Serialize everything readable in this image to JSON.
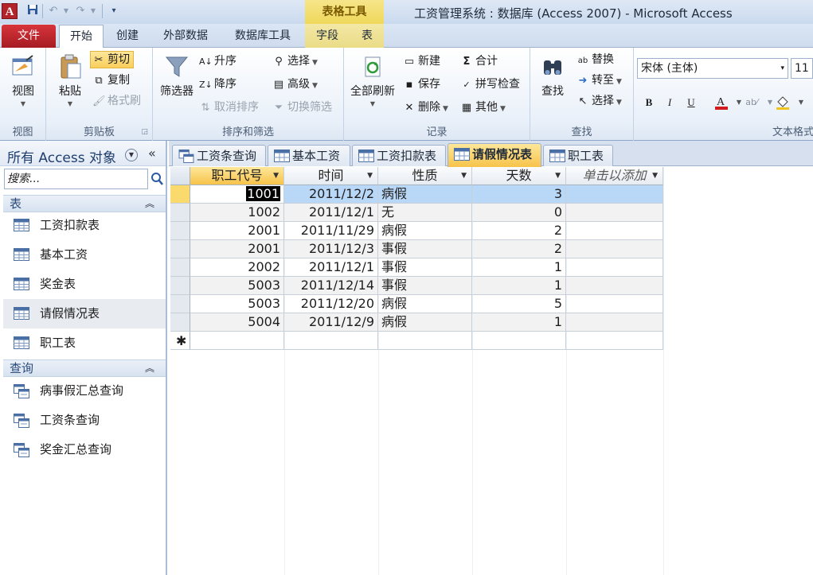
{
  "window": {
    "title": "工资管理系统 : 数据库 (Access 2007)  -  Microsoft Access",
    "context_tab_title": "表格工具",
    "app_icon_letter": "A"
  },
  "ribbon_tabs": [
    "文件",
    "开始",
    "创建",
    "外部数据",
    "数据库工具",
    "字段",
    "表"
  ],
  "ribbon": {
    "view": {
      "label": "视图",
      "group": "视图"
    },
    "clipboard": {
      "paste": "粘贴",
      "cut": "剪切",
      "copy": "复制",
      "format_painter": "格式刷",
      "group": "剪贴板"
    },
    "sort_filter": {
      "filter": "筛选器",
      "ascending": "升序",
      "descending": "降序",
      "clear_sort": "取消排序",
      "selection": "选择",
      "advanced": "高级",
      "toggle_filter": "切换筛选",
      "group": "排序和筛选"
    },
    "records": {
      "refresh_all": "全部刷新",
      "new": "新建",
      "save": "保存",
      "delete": "删除",
      "totals": "合计",
      "spelling": "拼写检查",
      "more": "其他",
      "group": "记录"
    },
    "find": {
      "find": "查找",
      "replace": "替换",
      "goto": "转至",
      "select": "选择",
      "group": "查找"
    },
    "text_format": {
      "font": "宋体 (主体)",
      "size": "11",
      "bold": "B",
      "italic": "I",
      "underline": "U",
      "group": "文本格式"
    }
  },
  "nav_pane": {
    "title": "所有 Access 对象",
    "search_placeholder": "搜索...",
    "sections": [
      {
        "label": "表",
        "items": [
          "工资扣款表",
          "基本工资",
          "奖金表",
          "请假情况表",
          "职工表"
        ]
      },
      {
        "label": "查询",
        "items": [
          "病事假汇总查询",
          "工资条查询",
          "奖金汇总查询"
        ]
      }
    ],
    "selected_item": "请假情况表"
  },
  "doc_tabs": [
    "工资条查询",
    "基本工资",
    "工资扣款表",
    "请假情况表",
    "职工表"
  ],
  "active_doc_tab": "请假情况表",
  "datasheet": {
    "columns": [
      "职工代号",
      "时间",
      "性质",
      "天数",
      "单击以添加"
    ],
    "rows": [
      [
        "1001",
        "2011/12/2",
        "病假",
        "3"
      ],
      [
        "1002",
        "2011/12/1",
        "无",
        "0"
      ],
      [
        "2001",
        "2011/11/29",
        "病假",
        "2"
      ],
      [
        "2001",
        "2011/12/3",
        "事假",
        "2"
      ],
      [
        "2002",
        "2011/12/1",
        "事假",
        "1"
      ],
      [
        "5003",
        "2011/12/14",
        "事假",
        "1"
      ],
      [
        "5003",
        "2011/12/20",
        "病假",
        "5"
      ],
      [
        "5004",
        "2011/12/9",
        "病假",
        "1"
      ]
    ],
    "new_row_marker": "✱"
  }
}
